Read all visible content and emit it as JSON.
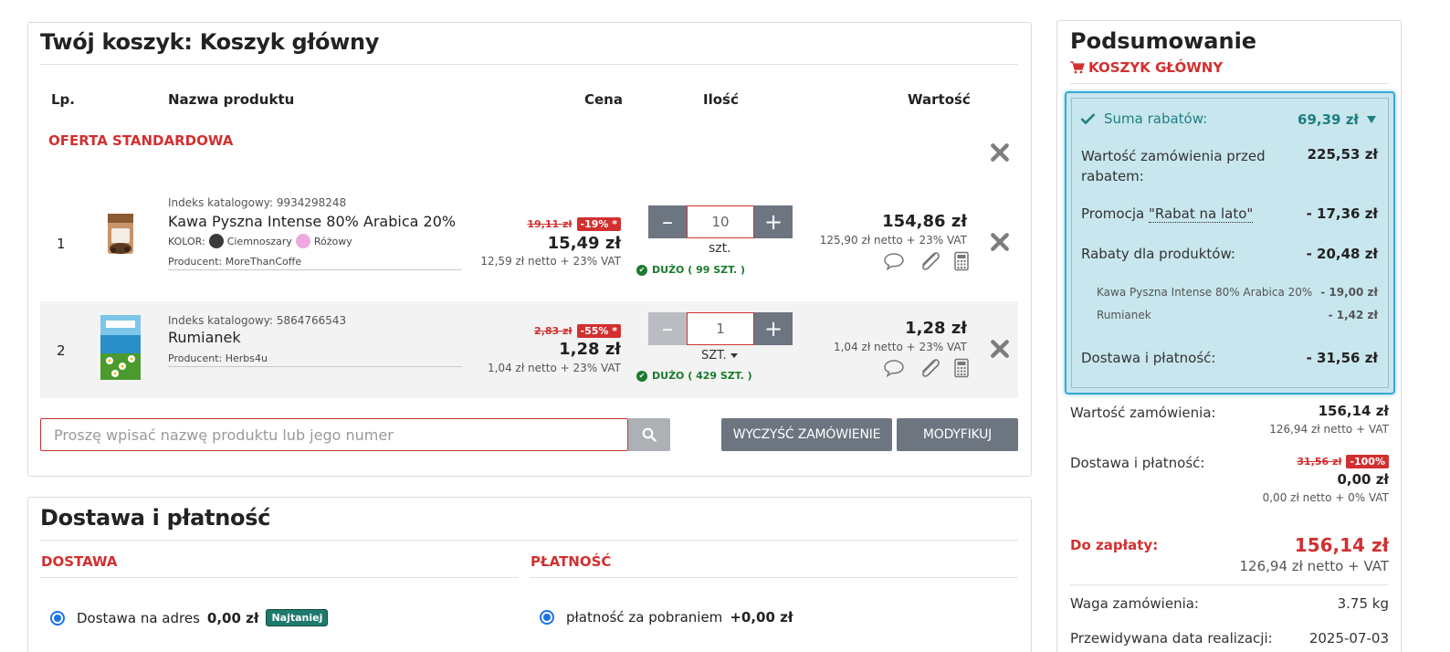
{
  "cart": {
    "title": "Twój koszyk: Koszyk główny",
    "columns": {
      "lp": "Lp.",
      "name": "Nazwa produktu",
      "price": "Cena",
      "qty": "Ilość",
      "value": "Wartość"
    },
    "offer_label": "OFERTA STANDARDOWA",
    "items": [
      {
        "lp": "1",
        "catalog_index": "Indeks katalogowy: 9934298248",
        "name": "Kawa Pyszna Intense 80% Arabica 20%",
        "color_label": "KOLOR:",
        "colors": [
          {
            "name": "Ciemnoszary",
            "hex": "#3a3a3a"
          },
          {
            "name": "Różowy",
            "hex": "#f0a8e0"
          }
        ],
        "producer": "Producent: MoreThanCoffe",
        "old_price": "19,11 zł",
        "discount": "-19% *",
        "price": "15,49 zł",
        "price_net": "12,59 zł netto + 23% VAT",
        "qty": "10",
        "unit": "szt.",
        "stock": "DUŻO ( 99 SZT. )",
        "value": "154,86 zł",
        "value_net": "125,90 zł netto + 23% VAT"
      },
      {
        "lp": "2",
        "catalog_index": "Indeks katalogowy: 5864766543",
        "name": "Rumianek",
        "producer": "Producent: Herbs4u",
        "old_price": "2,83 zł",
        "discount": "-55% *",
        "price": "1,28 zł",
        "price_net": "1,04 zł netto + 23% VAT",
        "qty": "1",
        "unit": "SZT.",
        "stock": "DUŻO ( 429 SZT. )",
        "value": "1,28 zł",
        "value_net": "1,04 zł netto + 23% VAT"
      }
    ],
    "search_placeholder": "Proszę wpisać nazwę produktu lub jego numer",
    "clear_label": "WYCZYŚĆ ZAMÓWIENIE",
    "modify_label": "MODYFIKUJ"
  },
  "delivery": {
    "title": "Dostawa i płatność",
    "shipping_label": "DOSTAWA",
    "payment_label": "PŁATNOŚĆ",
    "shipping_option": {
      "name": "Dostawa na adres",
      "price": "0,00 zł",
      "badge": "Najtaniej"
    },
    "payment_option": {
      "name": "płatność za pobraniem",
      "price": "+0,00 zł"
    }
  },
  "summary": {
    "title": "Podsumowanie",
    "cart_name": "KOSZYK GŁÓWNY",
    "discounts": {
      "total_label": "Suma rabatów:",
      "total_value": "69,39 zł",
      "before_label": "Wartość zamówienia przed rabatem:",
      "before_value": "225,53 zł",
      "promo_prefix": "Promocja ",
      "promo_name": "\"Rabat na lato\"",
      "promo_value": "- 17,36 zł",
      "products_label": "Rabaty dla produktów:",
      "products_value": "- 20,48 zł",
      "product_lines": [
        {
          "name": "Kawa Pyszna Intense 80% Arabica 20%",
          "value": "- 19,00 zł"
        },
        {
          "name": "Rumianek",
          "value": "- 1,42 zł"
        }
      ],
      "delivery_label": "Dostawa i płatność:",
      "delivery_value": "- 31,56 zł"
    },
    "order_value_label": "Wartość zamówienia:",
    "order_value": "156,14 zł",
    "order_value_net": "126,94 zł netto + VAT",
    "delivery_label": "Dostawa i płatność:",
    "delivery_old": "31,56 zł",
    "delivery_discount": "-100%",
    "delivery_value": "0,00 zł",
    "delivery_net": "0,00 zł netto + 0% VAT",
    "to_pay_label": "Do zapłaty:",
    "to_pay": "156,14 zł",
    "to_pay_net": "126,94 zł netto + VAT",
    "weight_label": "Waga zamówienia:",
    "weight": "3.75 kg",
    "date_label": "Przewidywana data realizacji:",
    "date": "2025-07-03"
  },
  "colors": {
    "accent_red": "#d23030",
    "button_gray": "#6c7580",
    "stock_green": "#1a7a2e",
    "discount_bg": "#c8e6ee",
    "teal": "#1f7f7f"
  },
  "icons": [
    "close-icon",
    "comment-icon",
    "attachment-icon",
    "calculator-icon",
    "check-circle-icon",
    "search-icon",
    "cart-icon",
    "check-icon",
    "caret-down-icon"
  ]
}
